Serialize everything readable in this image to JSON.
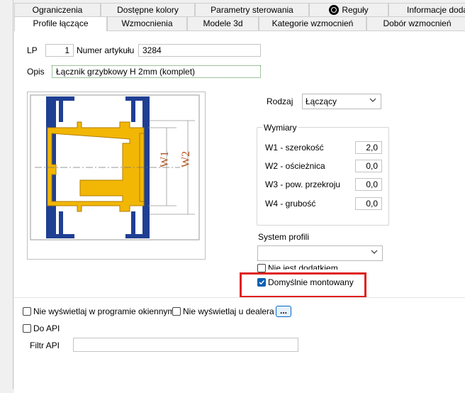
{
  "tabs_top": [
    {
      "label": "Ograniczenia"
    },
    {
      "label": "Dostępne kolory"
    },
    {
      "label": "Parametry sterowania"
    },
    {
      "label": "Reguły"
    },
    {
      "label": "Informacje dodatkowe"
    }
  ],
  "tabs_bottom": [
    {
      "label": "Profile łączące"
    },
    {
      "label": "Wzmocnienia"
    },
    {
      "label": "Modele 3d"
    },
    {
      "label": "Kategorie wzmocnień"
    },
    {
      "label": "Dobór wzmocnień"
    }
  ],
  "form": {
    "lp_label": "LP",
    "lp_value": "1",
    "article_label": "Numer artykułu",
    "article_value": "3284",
    "opis_label": "Opis",
    "opis_value": "Łącznik grzybkowy H 2mm (komplet)",
    "rodzaj_label": "Rodzaj",
    "rodzaj_value": "Łączący",
    "wymiary_title": "Wymiary",
    "dims": [
      {
        "label": "W1 - szerokość",
        "value": "2,0"
      },
      {
        "label": "W2 - ościeżnica",
        "value": "0,0"
      },
      {
        "label": "W3 - pow. przekroju",
        "value": "0,0"
      },
      {
        "label": "W4 - grubość",
        "value": "0,0"
      }
    ],
    "system_label": "System profili",
    "system_value": "",
    "not_additional_label": "Nie jest dodatkiem",
    "not_additional_checked": false,
    "default_mounted_label": "Domyślnie montowany",
    "default_mounted_checked": true,
    "hide_window_label": "Nie wyświetlaj w programie okiennym",
    "hide_window_checked": false,
    "hide_dealer_label": "Nie wyświetlaj u dealera",
    "hide_dealer_checked": false,
    "dots_label": "...",
    "api_label": "Do API",
    "api_checked": false,
    "filter_label": "Filtr API",
    "filter_value": ""
  },
  "drawing": {
    "w1_label": "W1",
    "w2_label": "W2"
  },
  "colors": {
    "profile_blue": "#1f3f93",
    "connector_yellow": "#f2b705",
    "highlight_red": "#e02020",
    "checkbox_blue": "#0a5fb4"
  }
}
